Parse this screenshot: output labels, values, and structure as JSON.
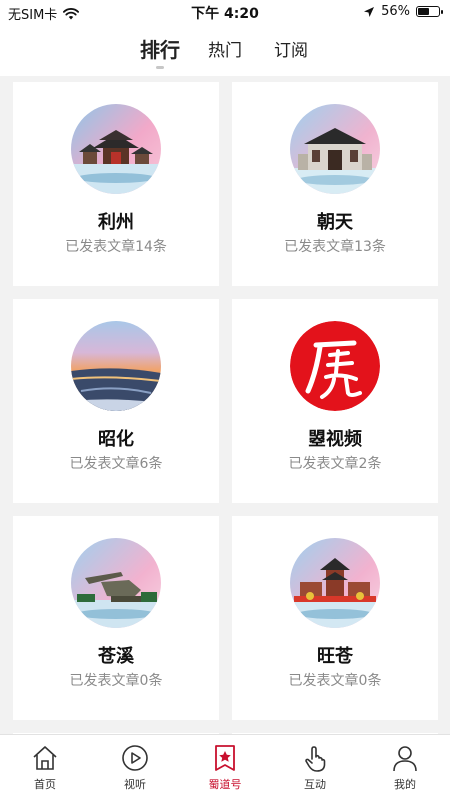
{
  "status_bar": {
    "carrier": "无SIM卡",
    "time": "下午 4:20",
    "battery_percent": "56%",
    "battery_level": 0.56
  },
  "header": {
    "tabs": [
      {
        "label": "排行",
        "active": true
      },
      {
        "label": "热门",
        "active": false
      },
      {
        "label": "订阅",
        "active": false
      }
    ]
  },
  "cards": [
    {
      "name": "利州",
      "count": "已发表文章14条",
      "icon": "pavilion-landscape-image"
    },
    {
      "name": "朝天",
      "count": "已发表文章13条",
      "icon": "gate-landscape-image"
    },
    {
      "name": "昭化",
      "count": "已发表文章6条",
      "icon": "sunset-river-image"
    },
    {
      "name": "曌视频",
      "count": "已发表文章2条",
      "icon": "red-seal-logo"
    },
    {
      "name": "苍溪",
      "count": "已发表文章0条",
      "icon": "sculpture-landscape-image"
    },
    {
      "name": "旺苍",
      "count": "已发表文章0条",
      "icon": "tower-landscape-image"
    }
  ],
  "bottom_nav": [
    {
      "label": "首页",
      "icon": "home-icon",
      "active": false
    },
    {
      "label": "视听",
      "icon": "play-icon",
      "active": false
    },
    {
      "label": "蜀道号",
      "icon": "bookmark-star-icon",
      "active": true
    },
    {
      "label": "互动",
      "icon": "hand-tap-icon",
      "active": false
    },
    {
      "label": "我的",
      "icon": "user-icon",
      "active": false
    }
  ],
  "colors": {
    "accent": "#c8102e",
    "background": "#f2f2f2",
    "card": "#ffffff",
    "muted_text": "#8a8a8a"
  }
}
